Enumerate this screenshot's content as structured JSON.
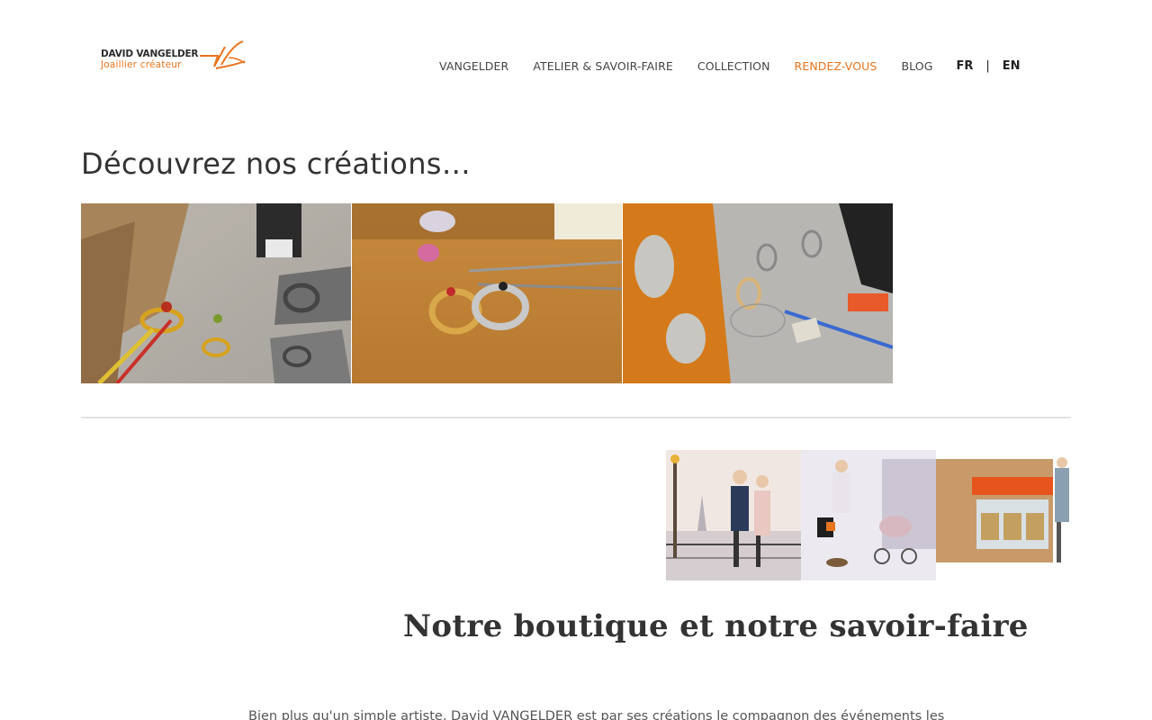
{
  "logo": {
    "line1": "DAVID VANGELDER",
    "line2": "Joaillier  créateur",
    "brand_color": "#e8741e"
  },
  "nav": {
    "items": [
      {
        "label": "VANGELDER",
        "active": false
      },
      {
        "label": "ATELIER & SAVOIR-FAIRE",
        "active": false
      },
      {
        "label": "COLLECTION",
        "active": false
      },
      {
        "label": "RENDEZ-VOUS",
        "active": true
      },
      {
        "label": "BLOG",
        "active": false
      }
    ],
    "lang_fr": "FR",
    "lang_sep": "|",
    "lang_en": "EN"
  },
  "creations": {
    "title": "Découvrez nos créations…",
    "images": [
      {
        "name": "gallery-image-rings-sketches"
      },
      {
        "name": "gallery-image-wedding-rings"
      },
      {
        "name": "gallery-image-design-tools"
      }
    ]
  },
  "boutique": {
    "title": "Notre boutique et notre savoir-faire",
    "paragraph": "Bien plus qu'un simple artiste, David VANGELDER est par ses créations le compagnon des événements les"
  }
}
